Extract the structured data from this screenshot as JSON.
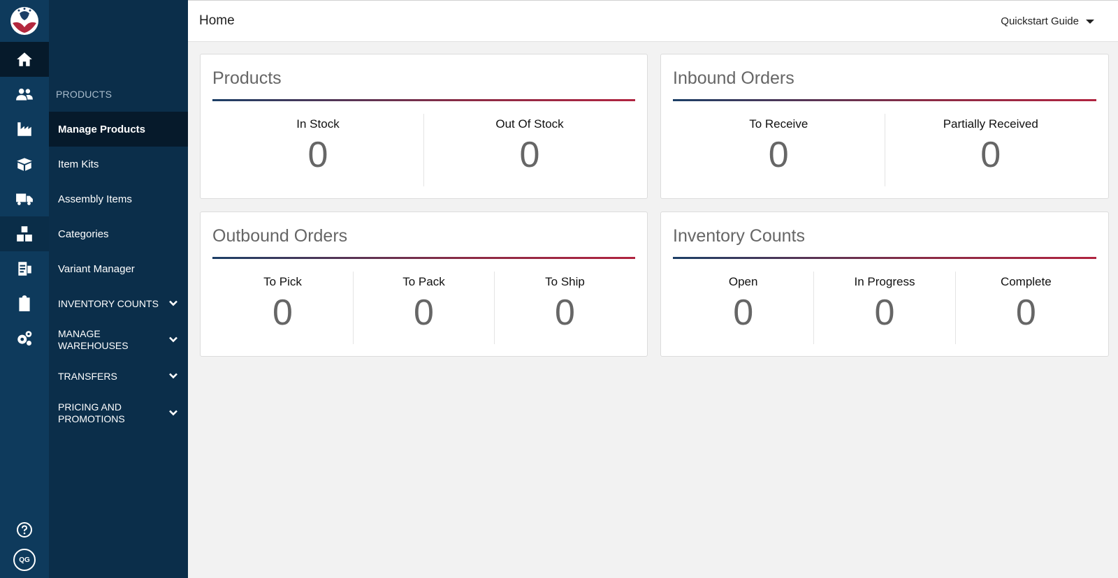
{
  "header": {
    "title": "Home",
    "quickstart_label": "Quickstart Guide"
  },
  "rail": {
    "icons": [
      "home-icon",
      "users-icon",
      "factory-icon",
      "open-box-icon",
      "delivery-truck-icon",
      "boxes-icon",
      "clipboard-list-icon",
      "clipboard-icon",
      "gears-icon"
    ],
    "help_icon": "question-circle-icon",
    "user_initials": "QG"
  },
  "subnav": {
    "section_label": "PRODUCTS",
    "items": [
      {
        "label": "Manage Products",
        "active": true
      },
      {
        "label": "Item Kits"
      },
      {
        "label": "Assembly Items"
      },
      {
        "label": "Categories"
      },
      {
        "label": "Variant Manager"
      }
    ],
    "groups": [
      {
        "label": "INVENTORY COUNTS"
      },
      {
        "label": "MANAGE WAREHOUSES"
      },
      {
        "label": "TRANSFERS"
      },
      {
        "label": "PRICING AND PROMOTIONS"
      }
    ]
  },
  "cards": {
    "products": {
      "title": "Products",
      "stats": [
        {
          "label": "In Stock",
          "value": "0"
        },
        {
          "label": "Out Of Stock",
          "value": "0"
        }
      ]
    },
    "inbound": {
      "title": "Inbound Orders",
      "stats": [
        {
          "label": "To Receive",
          "value": "0"
        },
        {
          "label": "Partially Received",
          "value": "0"
        }
      ]
    },
    "outbound": {
      "title": "Outbound Orders",
      "stats": [
        {
          "label": "To Pick",
          "value": "0"
        },
        {
          "label": "To Pack",
          "value": "0"
        },
        {
          "label": "To Ship",
          "value": "0"
        }
      ]
    },
    "counts": {
      "title": "Inventory Counts",
      "stats": [
        {
          "label": "Open",
          "value": "0"
        },
        {
          "label": "In Progress",
          "value": "0"
        },
        {
          "label": "Complete",
          "value": "0"
        }
      ]
    }
  },
  "colors": {
    "rail_bg": "#0e3a5c",
    "subnav_bg": "#0b2e4a",
    "active_bg": "#061a2b",
    "rule_start": "#1c3f66",
    "rule_end": "#b02440"
  }
}
